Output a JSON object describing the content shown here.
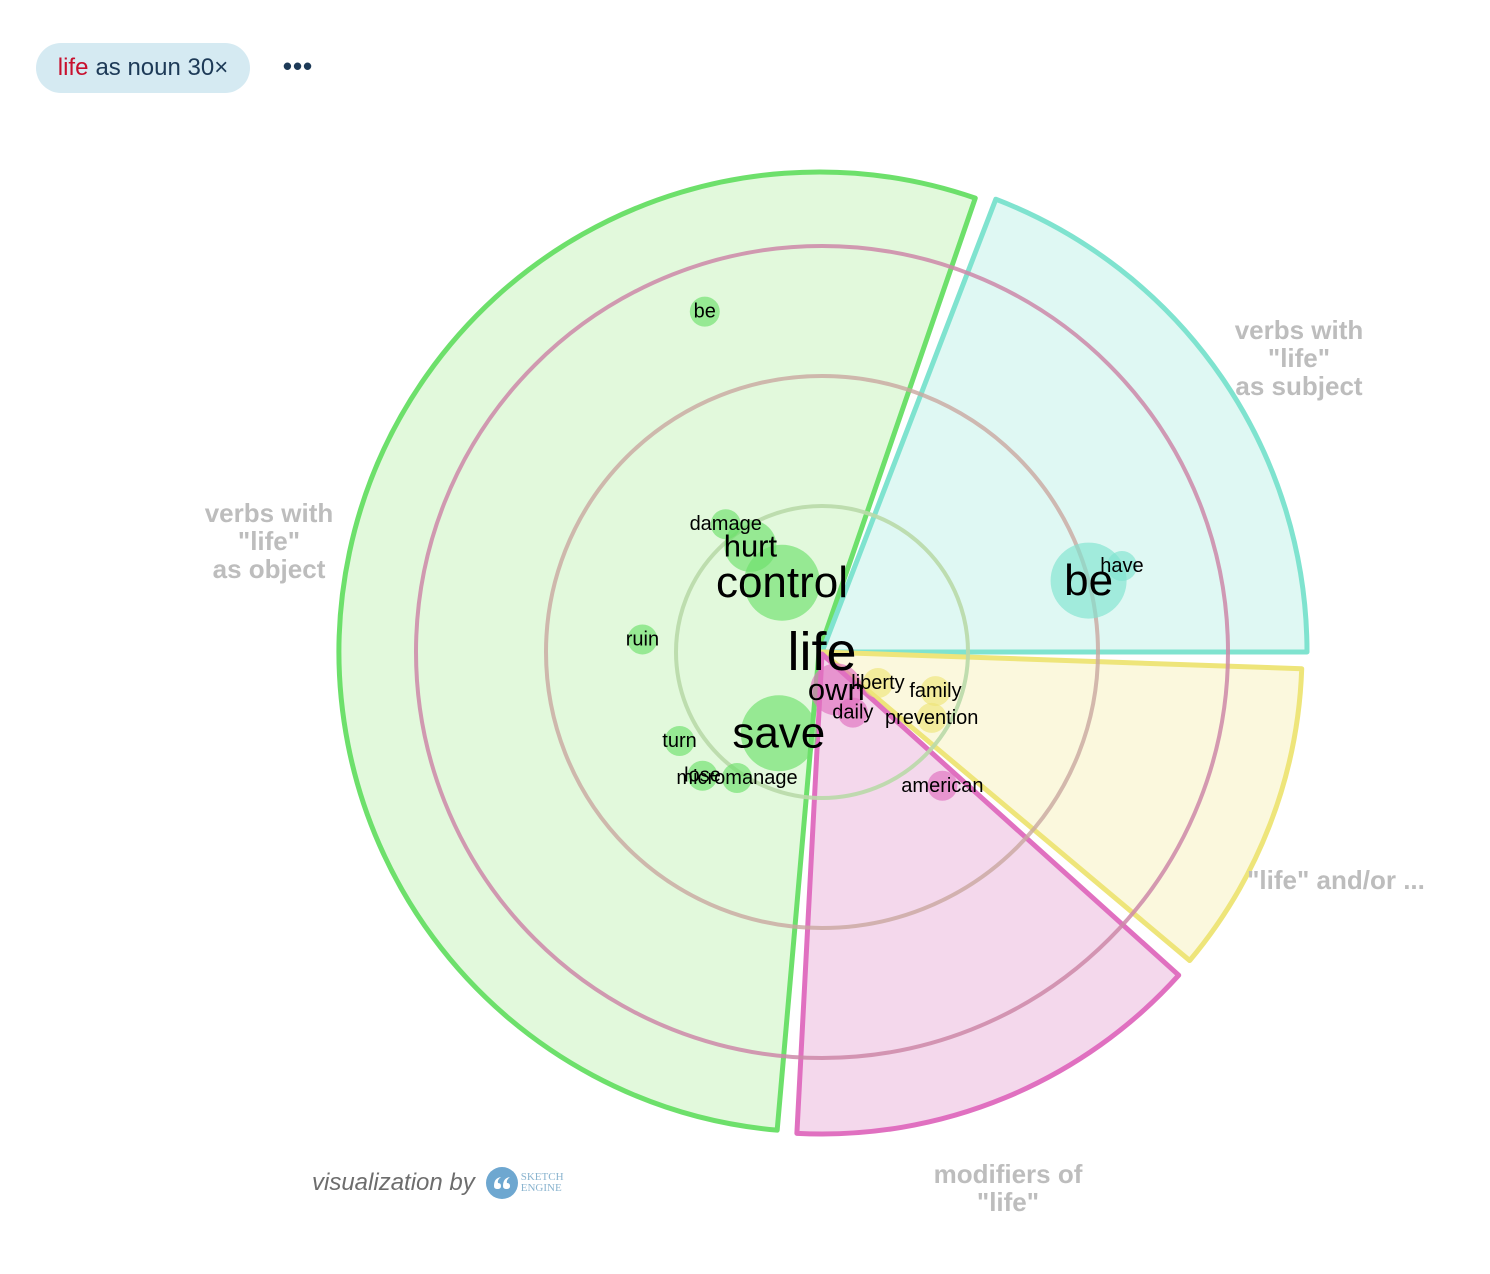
{
  "query_chip": {
    "keyword": "life",
    "rest": "as noun 30×",
    "more_label": "•••"
  },
  "credit": {
    "text": "visualization by",
    "logo_line1": "SKETCH",
    "logo_line2": "ENGINE"
  },
  "colors": {
    "green": "#6de06b",
    "green_fill": "#e2f9dc",
    "teal": "#7fe3cf",
    "teal_fill": "#dff8f3",
    "yellow": "#eee57a",
    "yellow_fill": "#fbf8dd",
    "pink": "#e070c0",
    "pink_fill": "#f4d8ec",
    "ring": "#cc88a8",
    "label_grey": "#bdbdbd"
  },
  "chart_data": {
    "type": "wordsketch-radial",
    "center_word": "life",
    "sections": [
      {
        "id": "object",
        "label_lines": [
          "verbs with",
          "\"life\"",
          "as object"
        ],
        "color_key": "green",
        "words": [
          {
            "word": "control",
            "dist": 0.2,
            "size": 3
          },
          {
            "word": "hurt",
            "dist": 0.32,
            "size": 2
          },
          {
            "word": "damage",
            "dist": 0.4,
            "size": 1
          },
          {
            "word": "ruin",
            "dist": 0.45,
            "size": 1
          },
          {
            "word": "save",
            "dist": 0.23,
            "size": 3
          },
          {
            "word": "turn",
            "dist": 0.42,
            "size": 1
          },
          {
            "word": "lose",
            "dist": 0.43,
            "size": 1
          },
          {
            "word": "micromanage",
            "dist": 0.38,
            "size": 1
          },
          {
            "word": "be",
            "dist": 0.9,
            "size": 1
          }
        ]
      },
      {
        "id": "subject",
        "label_lines": [
          "verbs with",
          "\"life\"",
          "as subject"
        ],
        "color_key": "teal",
        "words": [
          {
            "word": "be",
            "dist": 0.69,
            "size": 3
          },
          {
            "word": "have",
            "dist": 0.78,
            "size": 1
          }
        ]
      },
      {
        "id": "andor",
        "label_lines": [
          "\"life\" and/or ..."
        ],
        "color_key": "yellow",
        "words": [
          {
            "word": "liberty",
            "dist": 0.16,
            "size": 1
          },
          {
            "word": "family",
            "dist": 0.3,
            "size": 1
          },
          {
            "word": "prevention",
            "dist": 0.32,
            "size": 1
          }
        ]
      },
      {
        "id": "modifiers",
        "label_lines": [
          "modifiers of",
          "\"life\""
        ],
        "color_key": "pink",
        "words": [
          {
            "word": "own",
            "dist": 0.1,
            "size": 2
          },
          {
            "word": "daily",
            "dist": 0.17,
            "size": 1
          },
          {
            "word": "american",
            "dist": 0.45,
            "size": 1
          }
        ]
      }
    ]
  }
}
